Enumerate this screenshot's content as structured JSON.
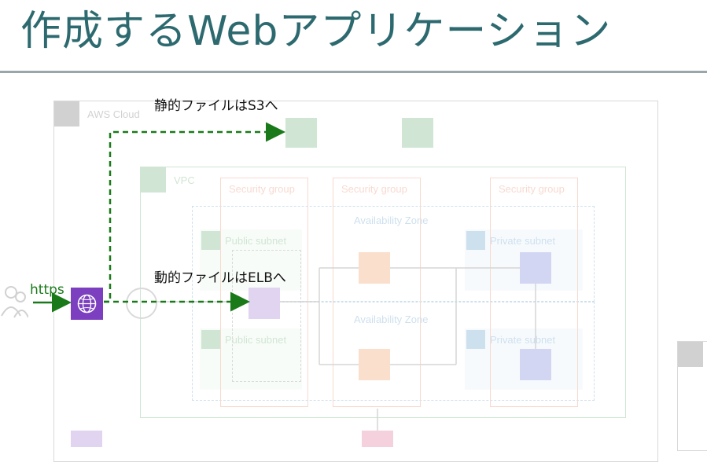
{
  "title": "作成するWebアプリケーション",
  "annotations": {
    "static": "静的ファイルはS3へ",
    "dynamic": "動的ファイルはELBへ",
    "https": "https"
  },
  "diagram": {
    "aws_cloud_label": "AWS Cloud",
    "vpc_label": "VPC",
    "security_group_labels": [
      "Security group",
      "Security group",
      "Security group"
    ],
    "availability_zone_labels": [
      "Availability Zone",
      "Availability Zone"
    ],
    "public_subnet_labels": [
      "Public subnet",
      "Public subnet"
    ],
    "private_subnet_labels": [
      "Private subnet",
      "Private subnet"
    ]
  },
  "colors": {
    "title": "#2d6a70",
    "arrow": "#1a7a1a",
    "cloudfront": "#7b3fc0",
    "security_group": "#e4572e",
    "subnet": "#2e8b3e",
    "compute": "#e8731a",
    "database": "#3b48cc"
  }
}
